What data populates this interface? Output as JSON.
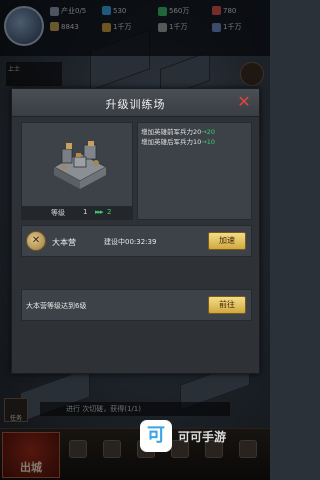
{
  "hud": {
    "resources": [
      {
        "icon": "industry-icon",
        "label": "产业0/5",
        "color": "#8a9ab0"
      },
      {
        "icon": "coin-icon",
        "label": "530",
        "color": "#3aa4e6"
      },
      {
        "icon": "money-icon",
        "label": "560万",
        "color": "#3fb86a"
      },
      {
        "icon": "gem-icon",
        "label": "780",
        "color": "#d95050"
      }
    ],
    "row2": [
      {
        "icon": "power-icon",
        "label": "8843",
        "color": "#c0a050"
      },
      {
        "icon": "res1-icon",
        "label": "1千万",
        "color": "#c89a40"
      },
      {
        "icon": "res2-icon",
        "label": "1千万",
        "color": "#a0a0a0"
      },
      {
        "icon": "res3-icon",
        "label": "1千万",
        "color": "#6a8ac0"
      }
    ],
    "left_tag": "上士",
    "task_text": "进行 次切磋，获得(1/1)",
    "left_side_label": "任务"
  },
  "nav": {
    "go_city": "出城",
    "items": [
      "",
      "",
      "",
      "",
      "",
      ""
    ]
  },
  "watermark": {
    "logo": "可",
    "text": "可可手游"
  },
  "modal": {
    "title": "升级训练场",
    "close": "✕",
    "level": {
      "label": "等级",
      "current": "1",
      "arrow": "▸▸▸",
      "next": "2"
    },
    "effects": [
      {
        "text": "增加英雄前军兵力20",
        "arrow": "→",
        "value": "20"
      },
      {
        "text": "增加英雄后军兵力10",
        "arrow": "→",
        "value": "10"
      }
    ],
    "requirements": [
      {
        "icon": "tools-icon",
        "name": "大本营",
        "status": "建设中00:32:39",
        "button": "加速"
      },
      {
        "text": "大本营等级达到6级",
        "button": "前往"
      }
    ]
  }
}
